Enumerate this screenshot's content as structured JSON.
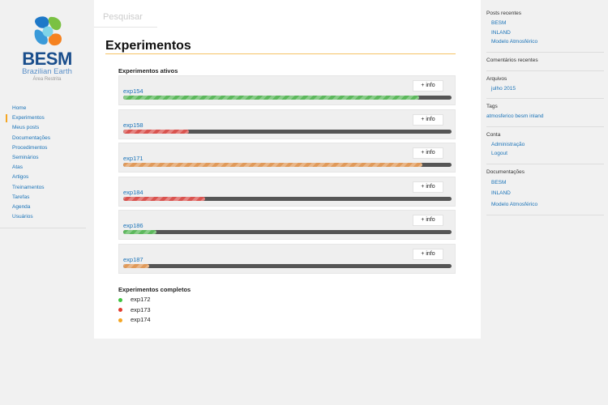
{
  "logo": {
    "name": "BESM",
    "subtitle": "Brazilian Earth",
    "area": "Área Restrita"
  },
  "nav": [
    {
      "label": "Home",
      "active": false
    },
    {
      "label": "Experimentos",
      "active": true
    },
    {
      "label": "Meus posts",
      "active": false
    },
    {
      "label": "Documentações",
      "active": false
    },
    {
      "label": "Procedimentos",
      "active": false
    },
    {
      "label": "Seminários",
      "active": false
    },
    {
      "label": "Atas",
      "active": false
    },
    {
      "label": "Artigos",
      "active": false
    },
    {
      "label": "Treinamentos",
      "active": false
    },
    {
      "label": "Tarefas",
      "active": false
    },
    {
      "label": "Agenda",
      "active": false
    },
    {
      "label": "Usuários",
      "active": false
    }
  ],
  "search": {
    "placeholder": "Pesquisar"
  },
  "main": {
    "title": "Experimentos",
    "active_heading": "Experimentos ativos",
    "info_label": "+ info",
    "active": [
      {
        "name": "exp154",
        "progress": 0.9,
        "color": "#5cb85c"
      },
      {
        "name": "exp158",
        "progress": 0.2,
        "color": "#d9534f"
      },
      {
        "name": "exp171",
        "progress": 0.91,
        "color": "#e09a5a"
      },
      {
        "name": "exp184",
        "progress": 0.25,
        "color": "#d9534f"
      },
      {
        "name": "exp186",
        "progress": 0.1,
        "color": "#5cb85c"
      },
      {
        "name": "exp187",
        "progress": 0.08,
        "color": "#e09a5a"
      }
    ],
    "completed_heading": "Experimentos completos",
    "completed": [
      {
        "name": "exp172",
        "color": "#3fc33f"
      },
      {
        "name": "exp173",
        "color": "#e23b2e"
      },
      {
        "name": "exp174",
        "color": "#f5a623"
      }
    ]
  },
  "right": {
    "posts": {
      "title": "Posts recentes",
      "items": [
        "BESM",
        "INLAND",
        "Modelo Atmosférico"
      ]
    },
    "comments": {
      "title": "Comentários recentes"
    },
    "archives": {
      "title": "Arquivos",
      "items": [
        "julho 2015"
      ]
    },
    "tags": {
      "title": "Tags",
      "text": "atmosferico besm inland"
    },
    "account": {
      "title": "Conta",
      "items": [
        "Administração",
        "Logout"
      ]
    },
    "docs": {
      "title": "Documentações",
      "items": [
        "BESM",
        "INLAND",
        "Modelo Atmosférico"
      ]
    }
  }
}
